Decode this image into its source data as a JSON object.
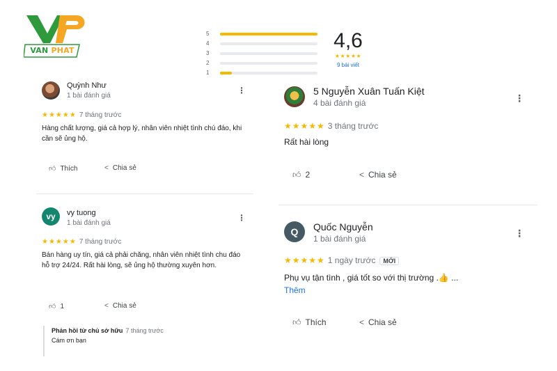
{
  "brand": {
    "logo_text_a": "VAN",
    "logo_text_b": "PHAT",
    "green": "#2e9a3c",
    "orange": "#f5a623"
  },
  "rating": {
    "average": "4,6",
    "stars": "★★★★★",
    "count_label": "9 bài viết",
    "histogram": [
      {
        "label": "5",
        "fraction": 1.0
      },
      {
        "label": "4",
        "fraction": 0.0
      },
      {
        "label": "3",
        "fraction": 0.0
      },
      {
        "label": "2",
        "fraction": 0.0
      },
      {
        "label": "1",
        "fraction": 0.12
      }
    ],
    "bar_color": "#f6b800"
  },
  "reviews_left": [
    {
      "name": "Quỳnh Như",
      "sub": "1 bài đánh giá",
      "stars": "★★★★★",
      "time": "7 tháng trước",
      "text": "Hàng chất lượng, giá cả hợp lý, nhân viên nhiệt tình chú đáo, khi cần sẽ ủng hộ.",
      "like_label": "Thích",
      "share_label": "Chia sẻ",
      "more_icon": "⋮"
    },
    {
      "name": "vy tuong",
      "avatar_letter": "vy",
      "sub": "1 bài đánh giá",
      "stars": "★★★★★",
      "time": "7 tháng trước",
      "text": "Bán hàng uy tín, giá cả phải chăng, nhân viên nhiệt tình chu đáo hỗ trợ 24/24. Rất hài lòng, sẽ ủng hộ thường xuyên hơn.",
      "like_count": "1",
      "share_label": "Chia sẻ",
      "more_icon": "⋮",
      "reply": {
        "title": "Phản hồi từ chủ sở hữu",
        "time": "7 tháng trước",
        "text": "Cám ơn bạn"
      }
    }
  ],
  "reviews_right": [
    {
      "name": "5 Nguyễn Xuân Tuấn Kiệt",
      "sub": "4 bài đánh giá",
      "stars": "★★★★★",
      "time": "3 tháng trước",
      "text": "Rất hài lòng",
      "like_count": "2",
      "share_label": "Chia sẻ",
      "more_icon": "⋮"
    },
    {
      "name": "Quốc Nguyễn",
      "avatar_letter": "Q",
      "sub": "1 bài đánh giá",
      "stars": "★★★★★",
      "time": "1 ngày trước",
      "badge": "MỚI",
      "text": "Phụ vụ tận tình , giá tốt so với thị trường .👍 ...",
      "more_link": "Thêm",
      "like_label": "Thích",
      "share_label": "Chia sẻ",
      "more_icon": "⋮"
    }
  ],
  "icons": {
    "like": "thumb-up-icon",
    "share": "share-icon",
    "more": "more-vert-icon"
  }
}
